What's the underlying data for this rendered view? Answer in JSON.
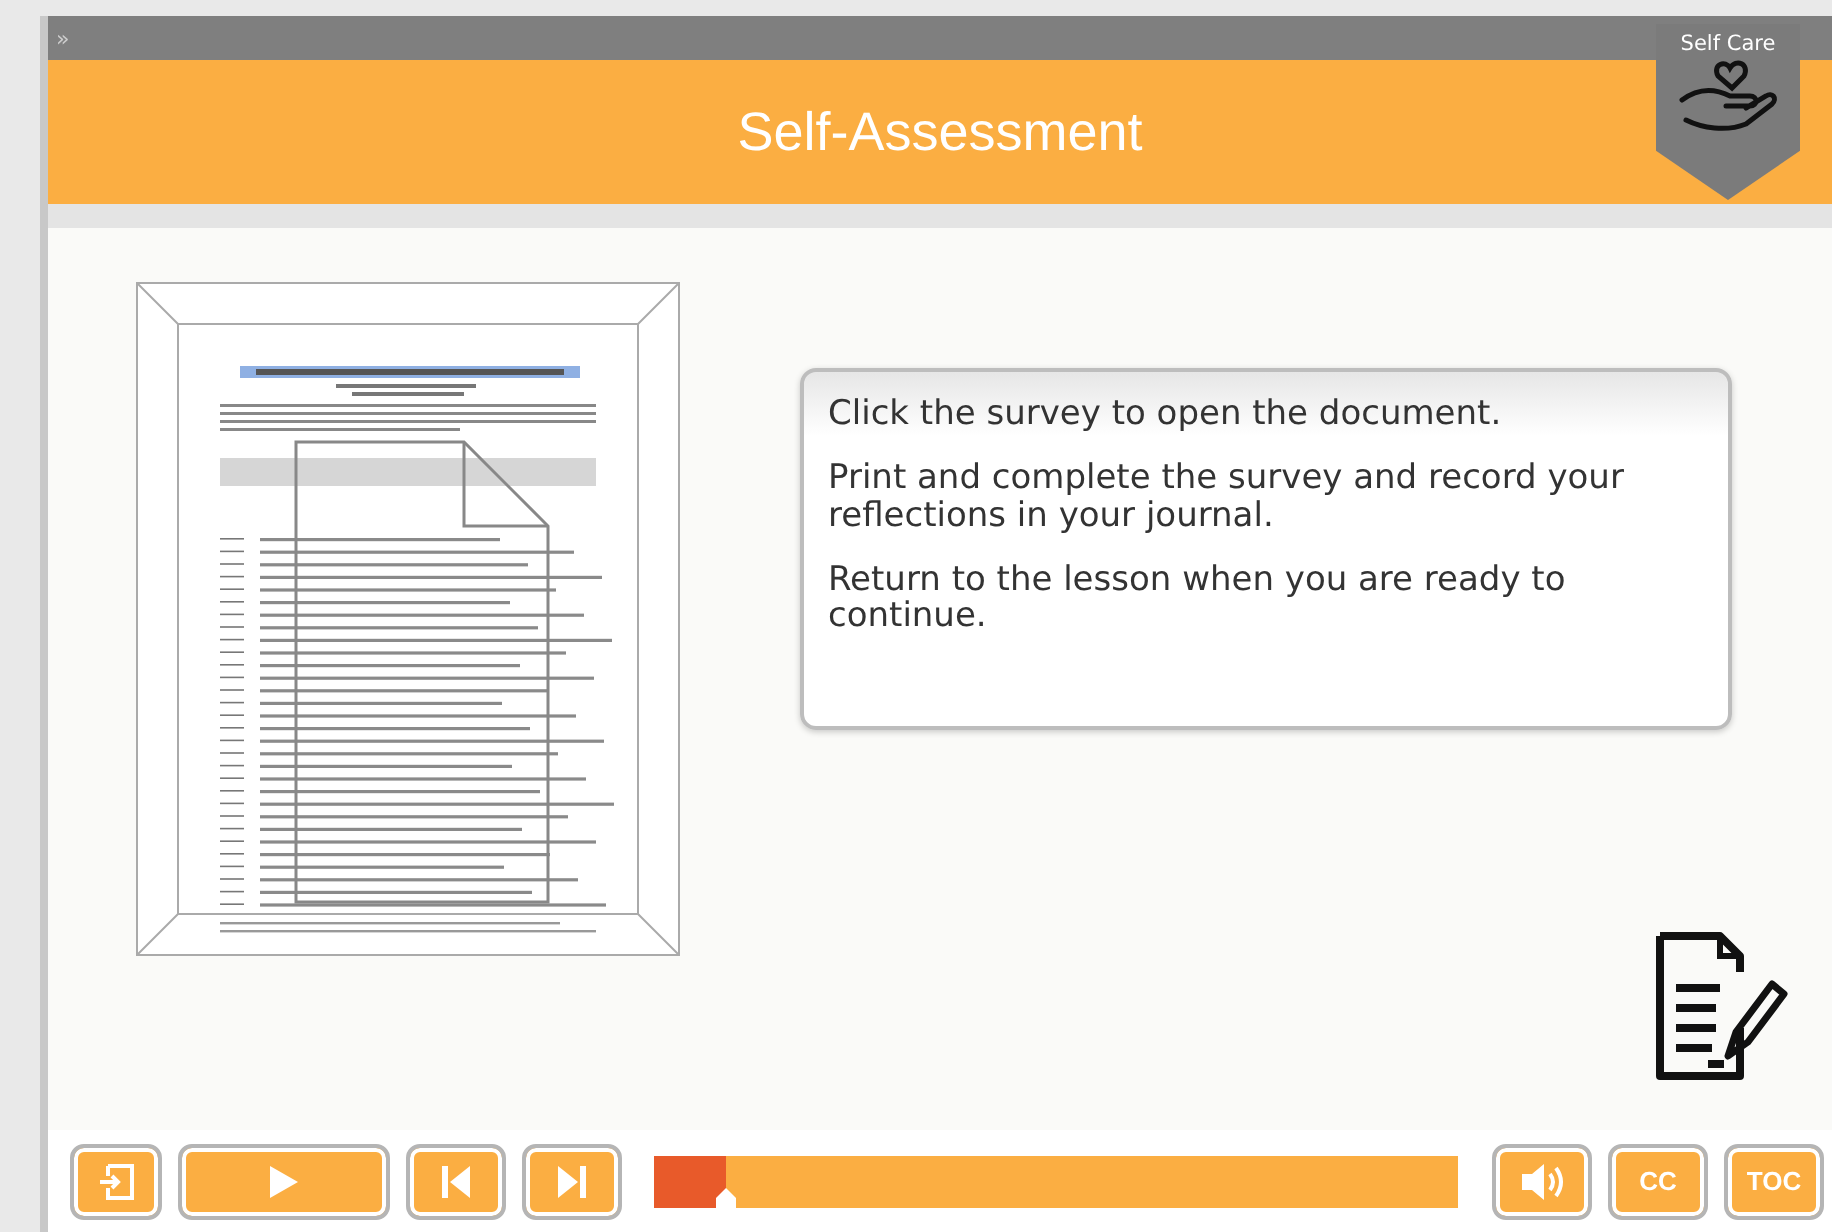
{
  "top_bar": {
    "expand_glyph": "»"
  },
  "header": {
    "title": "Self-Assessment",
    "badge": "Self Care"
  },
  "message": {
    "paragraphs": [
      "Click the survey to open the document.",
      "Print and complete the survey and record your reflections in your journal.",
      "Return to the lesson when you are ready to continue."
    ]
  },
  "controls": {
    "buttons": [
      {
        "kind": "exit"
      },
      {
        "kind": "play"
      },
      {
        "kind": "prev"
      },
      {
        "kind": "next"
      }
    ],
    "progress": {
      "level": 0.09
    },
    "right_buttons": [
      {
        "kind": "volume"
      },
      {
        "kind": "text",
        "label": "CC"
      },
      {
        "kind": "text",
        "label": "TOC"
      }
    ]
  }
}
